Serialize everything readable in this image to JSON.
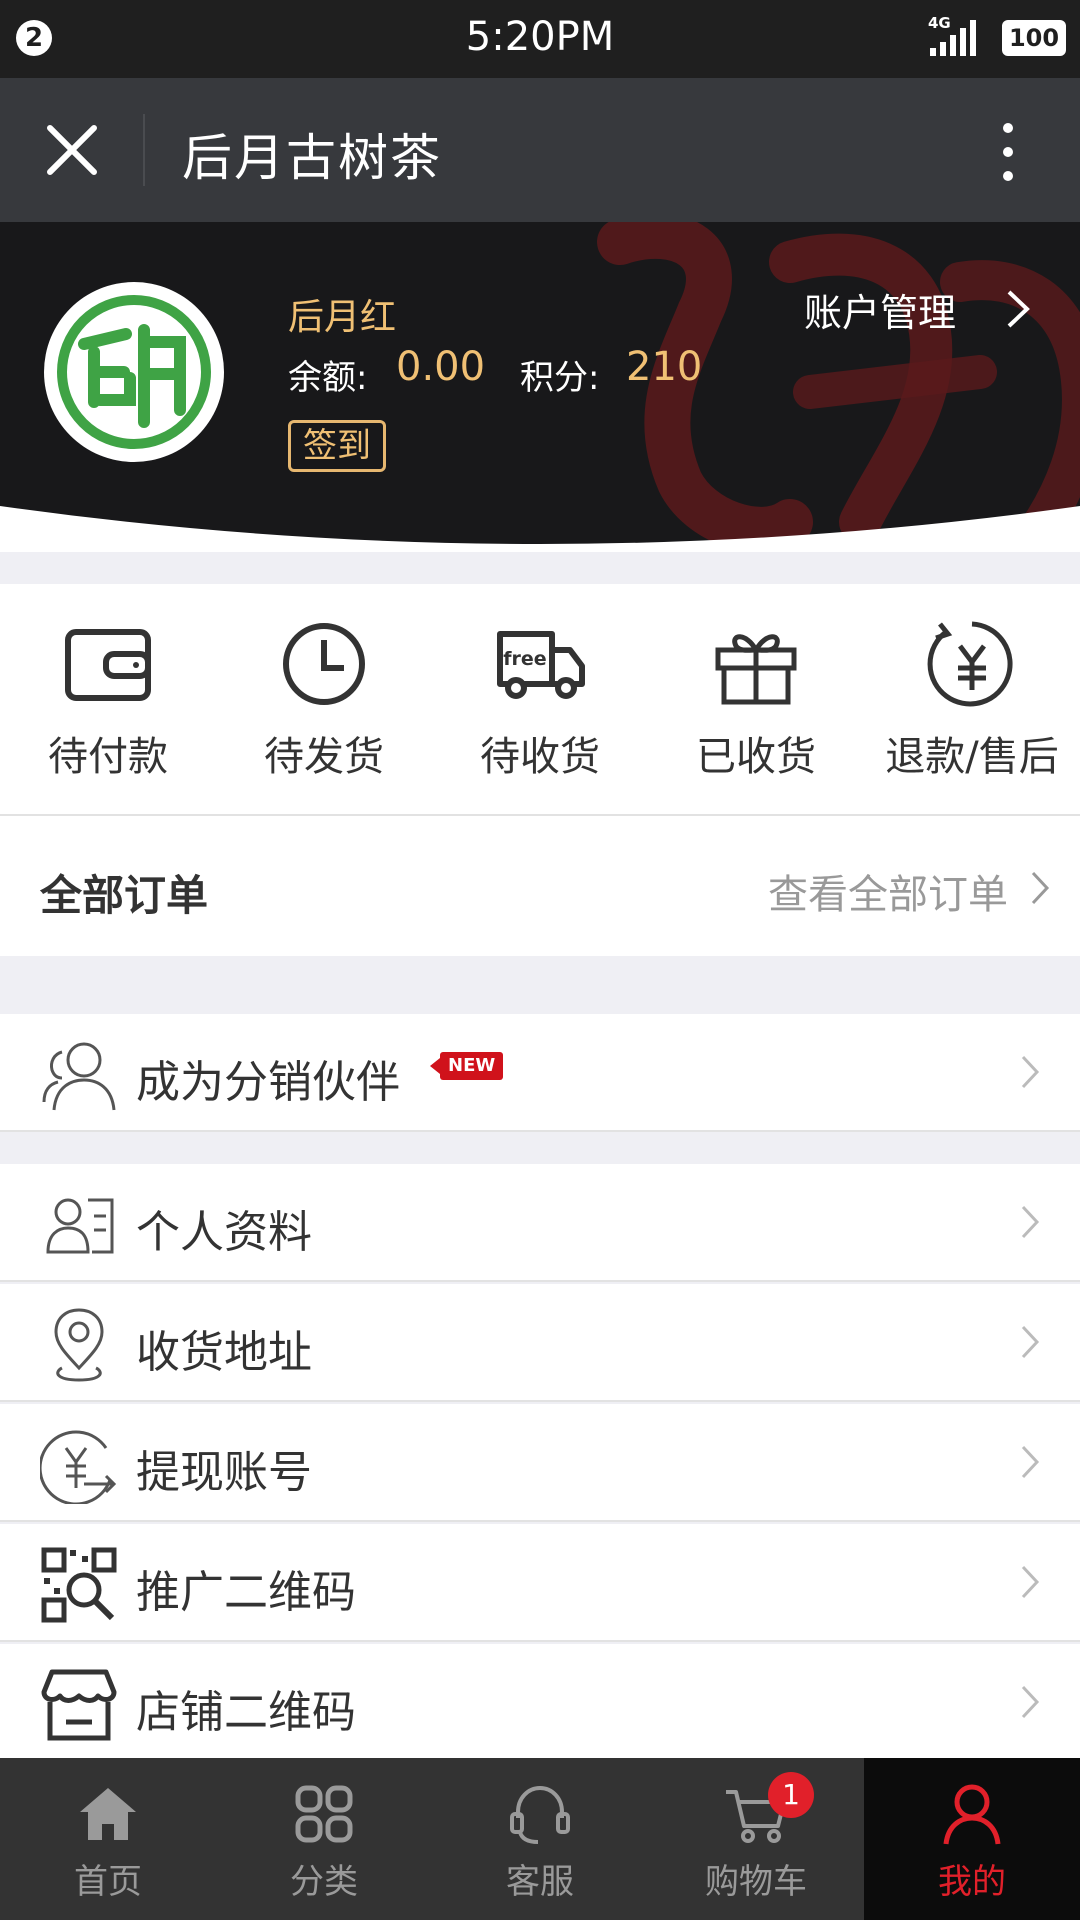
{
  "status_bar": {
    "notification_count": "2",
    "time": "5:20PM",
    "network": "4G",
    "battery": "100"
  },
  "header": {
    "title": "后月古树茶",
    "close_icon": "close-icon",
    "more_icon": "more-vertical-icon"
  },
  "profile": {
    "name": "后月红",
    "balance_label": "余额:",
    "balance_value": "0.00",
    "points_label": "积分:",
    "points_value": "210",
    "signin_label": "签到",
    "account_label": "账户管理"
  },
  "order_status": [
    {
      "label": "待付款",
      "icon": "wallet-icon"
    },
    {
      "label": "待发货",
      "icon": "clock-icon"
    },
    {
      "label": "待收货",
      "icon": "truck-icon",
      "icon_text": "free"
    },
    {
      "label": "已收货",
      "icon": "gift-icon"
    },
    {
      "label": "退款/售后",
      "icon": "refund-yen-icon"
    }
  ],
  "all_orders": {
    "title": "全部订单",
    "link": "查看全部订单"
  },
  "menu": {
    "distributor": {
      "label": "成为分销伙伴",
      "badge": "NEW",
      "icon": "partner-icon"
    },
    "items": [
      {
        "label": "个人资料",
        "icon": "profile-card-icon"
      },
      {
        "label": "收货地址",
        "icon": "location-icon"
      },
      {
        "label": "提现账号",
        "icon": "withdraw-icon"
      },
      {
        "label": "推广二维码",
        "icon": "qr-scan-icon"
      },
      {
        "label": "店铺二维码",
        "icon": "store-icon"
      }
    ]
  },
  "tabbar": {
    "items": [
      {
        "label": "首页",
        "icon": "home-icon"
      },
      {
        "label": "分类",
        "icon": "category-icon"
      },
      {
        "label": "客服",
        "icon": "headset-icon"
      },
      {
        "label": "购物车",
        "icon": "cart-icon"
      },
      {
        "label": "我的",
        "icon": "user-icon"
      }
    ],
    "cart_count": "1",
    "active": "我的"
  },
  "colors": {
    "accent_gold": "#f0c074",
    "active_red": "#e1202a",
    "nav_bg": "#37393d",
    "avatar_green": "#3fa345"
  }
}
